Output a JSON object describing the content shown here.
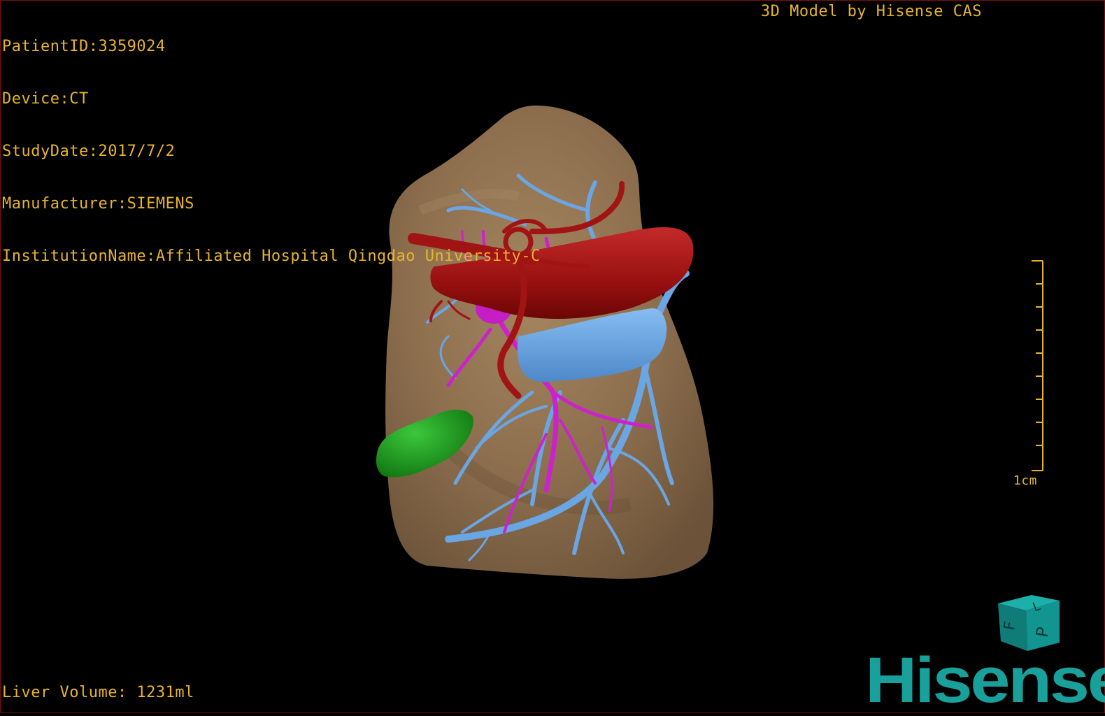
{
  "window": {
    "title": "3D Model by Hisense CAS"
  },
  "study_info": {
    "patient_id": "PatientID:3359024",
    "device": "Device:CT",
    "study_date": "StudyDate:2017/7/2",
    "manufacturer": "Manufacturer:SIEMENS",
    "institution": "InstitutionName:Affiliated Hospital Qingdao University-C"
  },
  "measurements": {
    "liver_volume": "Liver Volume: 1231ml",
    "scale_label": "1cm"
  },
  "orientation_cube": {
    "face_front": "F",
    "face_left": "L",
    "face_posterior": "P"
  },
  "brand": {
    "logo_text": "Hisense"
  },
  "colors": {
    "overlay_text": "#e8b52a",
    "liver": "#8c6e4e",
    "artery": "#a01414",
    "portal_vein": "#6aa6e4",
    "hepatic_vein": "#cc22cc",
    "gallbladder": "#1ea01e",
    "brand": "#1aa09a",
    "cube": "#128a86"
  }
}
